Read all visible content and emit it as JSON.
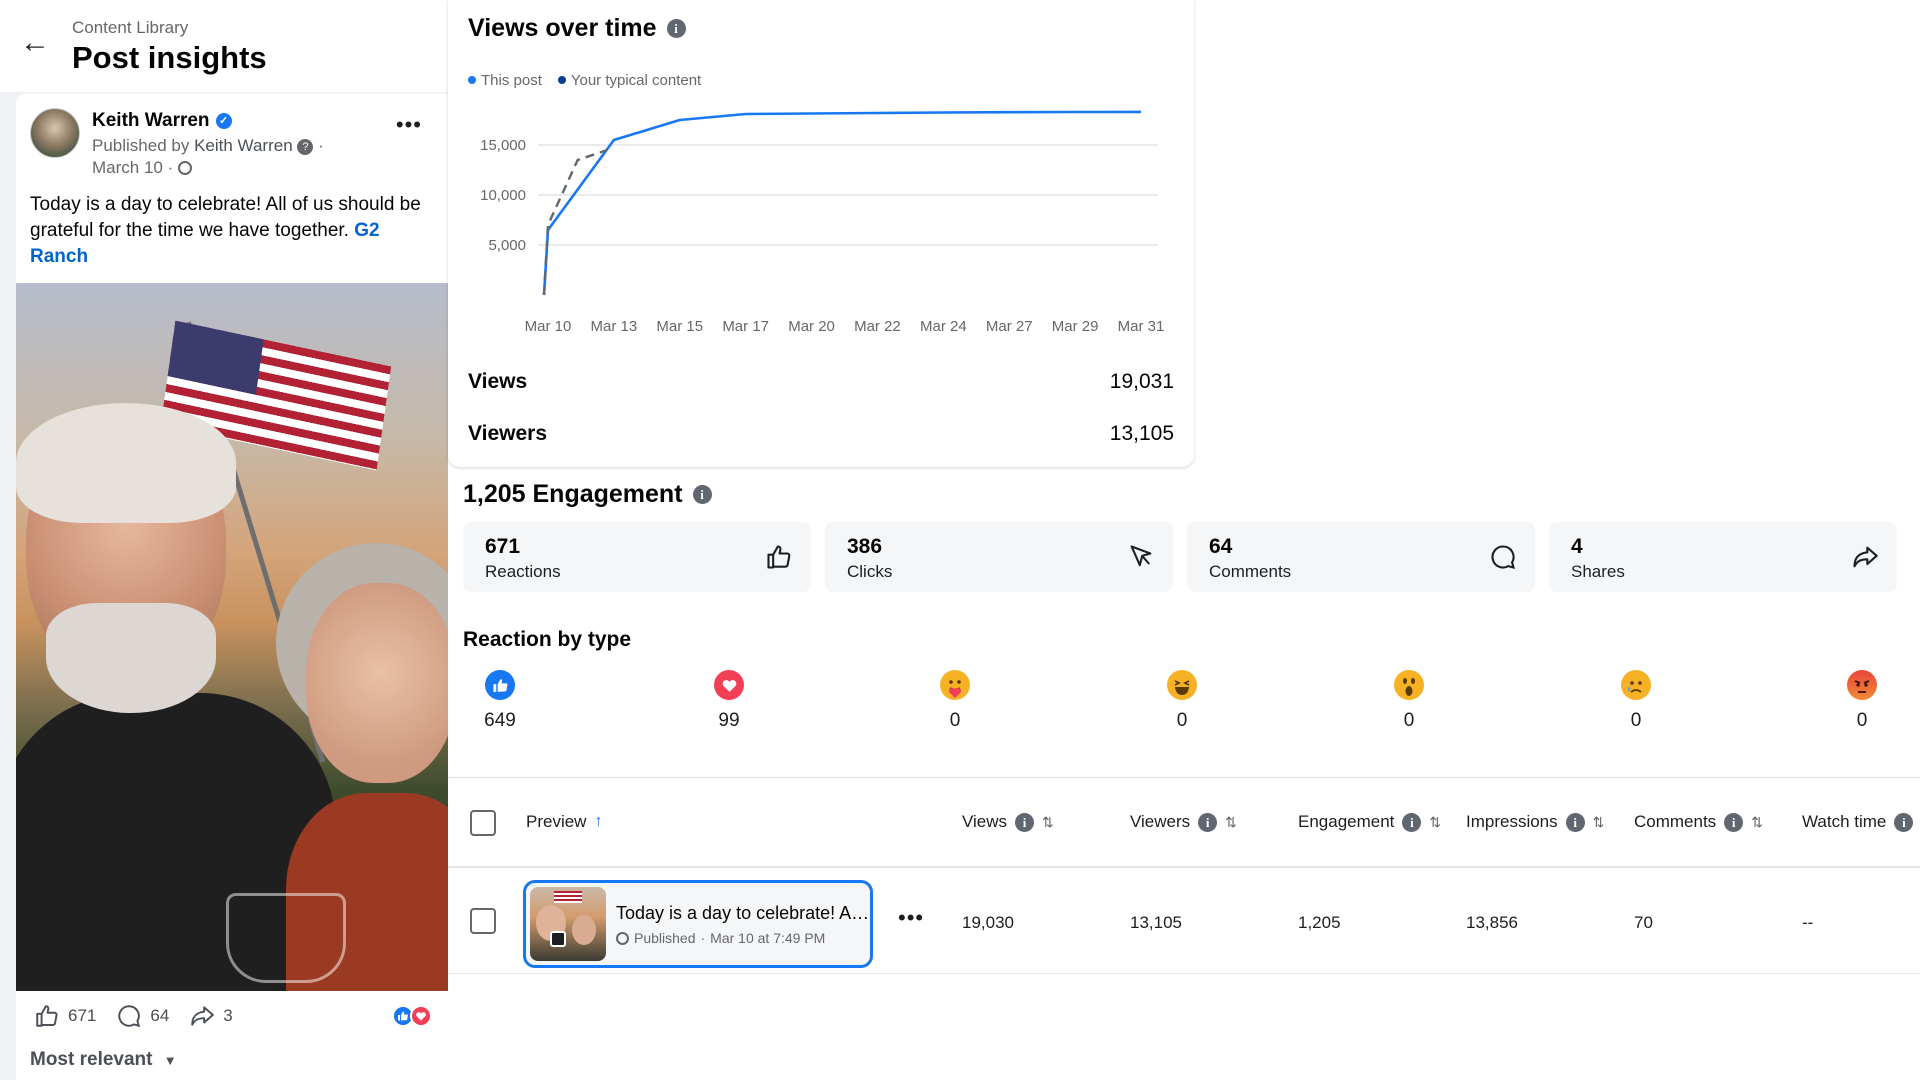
{
  "header": {
    "breadcrumb": "Content Library",
    "title": "Post insights"
  },
  "post": {
    "author": "Keith Warren",
    "published_by_prefix": "Published by",
    "published_by_name": "Keith Warren",
    "date": "March 10",
    "text": "Today is a day to celebrate! All of us should be grateful for the time we have together. ",
    "link": "G2 Ranch",
    "likes": "671",
    "comments": "64",
    "shares": "3",
    "sort_label": "Most relevant"
  },
  "views_chart": {
    "title": "Views over time",
    "legend": [
      "This post",
      "Your typical content"
    ],
    "colors": {
      "this_post": "#1877f2",
      "typical": "#0a3d91",
      "typical_line": "#606770"
    },
    "stats": [
      {
        "label": "Views",
        "value": "19,031"
      },
      {
        "label": "Viewers",
        "value": "13,105"
      }
    ]
  },
  "chart_data": {
    "type": "line",
    "x": [
      "Mar 10",
      "Mar 13",
      "Mar 15",
      "Mar 17",
      "Mar 20",
      "Mar 22",
      "Mar 24",
      "Mar 27",
      "Mar 29",
      "Mar 31"
    ],
    "yticks": [
      "5,000",
      "10,000",
      "15,000"
    ],
    "ylim": [
      0,
      20000
    ],
    "series": [
      {
        "name": "This post",
        "values": [
          6500,
          15500,
          17500,
          18100,
          18150,
          18200,
          18250,
          18280,
          18300,
          18310
        ]
      },
      {
        "name": "Your typical content",
        "values": [
          7000,
          13500,
          14500
        ]
      }
    ],
    "grid": true,
    "legend_position": "top-left"
  },
  "engagement": {
    "title": "1,205 Engagement",
    "cards": [
      {
        "num": "671",
        "label": "Reactions",
        "icon": "thumbs-up-icon"
      },
      {
        "num": "386",
        "label": "Clicks",
        "icon": "cursor-icon"
      },
      {
        "num": "64",
        "label": "Comments",
        "icon": "comment-icon"
      },
      {
        "num": "4",
        "label": "Shares",
        "icon": "share-icon"
      }
    ]
  },
  "reactions": {
    "title": "Reaction by type",
    "items": [
      {
        "type": "like",
        "count": "649"
      },
      {
        "type": "love",
        "count": "99"
      },
      {
        "type": "care",
        "count": "0"
      },
      {
        "type": "haha",
        "count": "0"
      },
      {
        "type": "wow",
        "count": "0"
      },
      {
        "type": "sad",
        "count": "0"
      },
      {
        "type": "angry",
        "count": "0"
      }
    ]
  },
  "table": {
    "headers": [
      "Preview",
      "Views",
      "Viewers",
      "Engagement",
      "Impressions",
      "Comments",
      "Watch time"
    ],
    "row": {
      "title": "Today is a day to celebrate! All of us should be grateful",
      "status": "Published",
      "date": "Mar 10 at 7:49 PM",
      "views": "19,030",
      "viewers": "13,105",
      "engagement": "1,205",
      "impressions": "13,856",
      "comments": "70",
      "watch_time": "--"
    }
  }
}
